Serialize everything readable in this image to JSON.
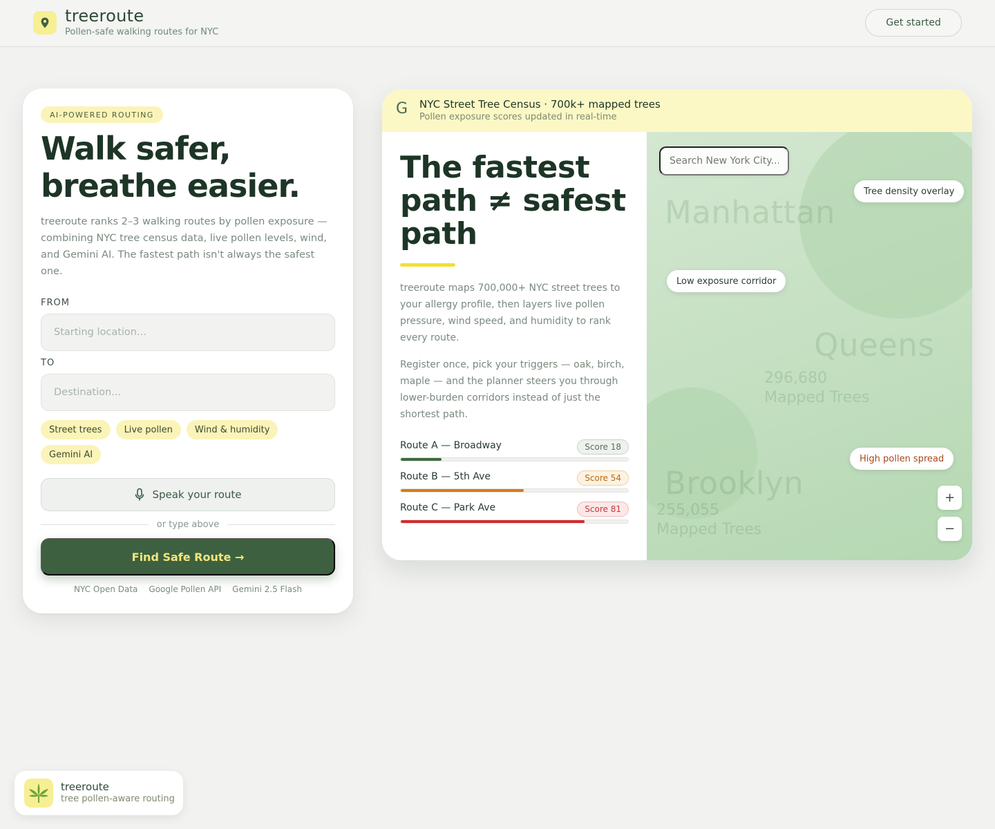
{
  "header": {
    "brand": "treeroute",
    "tagline": "Pollen-safe walking routes for NYC",
    "logo_icon": "map-pin-icon",
    "cta": "Get started"
  },
  "planner": {
    "badge": "AI-POWERED ROUTING",
    "title_line1": "Walk safer,",
    "title_line2": "breathe easier.",
    "description": "treeroute ranks 2–3 walking routes by pollen exposure — combining NYC tree census data, live pollen levels, wind, and Gemini AI. The fastest path isn't always the safest one.",
    "from_label": "FROM",
    "from_placeholder": "Starting location...",
    "from_value": "",
    "to_label": "TO",
    "to_placeholder": "Destination...",
    "to_value": "",
    "chips": [
      "Street trees",
      "Live pollen",
      "Wind & humidity",
      "Gemini AI"
    ],
    "speak_label": "Speak your route",
    "speak_icon": "microphone-icon",
    "divider_text": "or type above",
    "find_label": "Find Safe Route →",
    "sources": [
      "NYC Open Data",
      "Google Pollen API",
      "Gemini 2.5 Flash"
    ]
  },
  "census": {
    "icon_letter": "G",
    "title": "NYC Street Tree Census · 700k+ mapped trees",
    "subtitle": "Pollen exposure scores updated in real-time"
  },
  "info": {
    "title_line1": "The fastest",
    "title_line2": "path ≠ safest",
    "title_line3": "path",
    "paragraph1": "treeroute maps 700,000+ NYC street trees to your allergy profile, then layers live pollen pressure, wind speed, and humidity to rank every route.",
    "paragraph2": "Register once, pick your triggers — oak, birch, maple — and the planner steers you through lower-burden corridors instead of just the shortest path.",
    "routes": [
      {
        "name": "Route A — Broadway",
        "score_label": "Score 18",
        "score": 18,
        "color": "#3d6a3f",
        "badge_bg": "#eef1ee",
        "badge_border": "#c9d2ca",
        "badge_text": "#5c6e60"
      },
      {
        "name": "Route B — 5th Ave",
        "score_label": "Score 54",
        "score": 54,
        "color": "#d97a12",
        "badge_bg": "#fdf2e2",
        "badge_border": "#f0cfa0",
        "badge_text": "#b86a12"
      },
      {
        "name": "Route C — Park Ave",
        "score_label": "Score 81",
        "score": 81,
        "color": "#d42a2a",
        "badge_bg": "#fce8e8",
        "badge_border": "#f0b8b8",
        "badge_text": "#c43a3a"
      }
    ]
  },
  "map": {
    "search_placeholder": "Search New York City...",
    "overlay_pill": "Tree density overlay",
    "corridor_pill": "Low exposure corridor",
    "spread_pill": "High pollen spread",
    "boroughs": {
      "manhattan": "Manhattan",
      "queens": "Queens",
      "queens_count": "296,680",
      "queens_unit": "Mapped Trees",
      "brooklyn": "Brooklyn",
      "brooklyn_count": "255,055",
      "brooklyn_unit": "Mapped Trees"
    },
    "zoom_in": "+",
    "zoom_out": "−"
  },
  "footer": {
    "brand": "treeroute",
    "subtitle": "tree pollen-aware routing",
    "icon": "cannabis-leaf-icon"
  },
  "colors": {
    "accent_yellow": "#f6ef93",
    "primary_green": "#3d6140",
    "button_text": "#f3e67a"
  }
}
